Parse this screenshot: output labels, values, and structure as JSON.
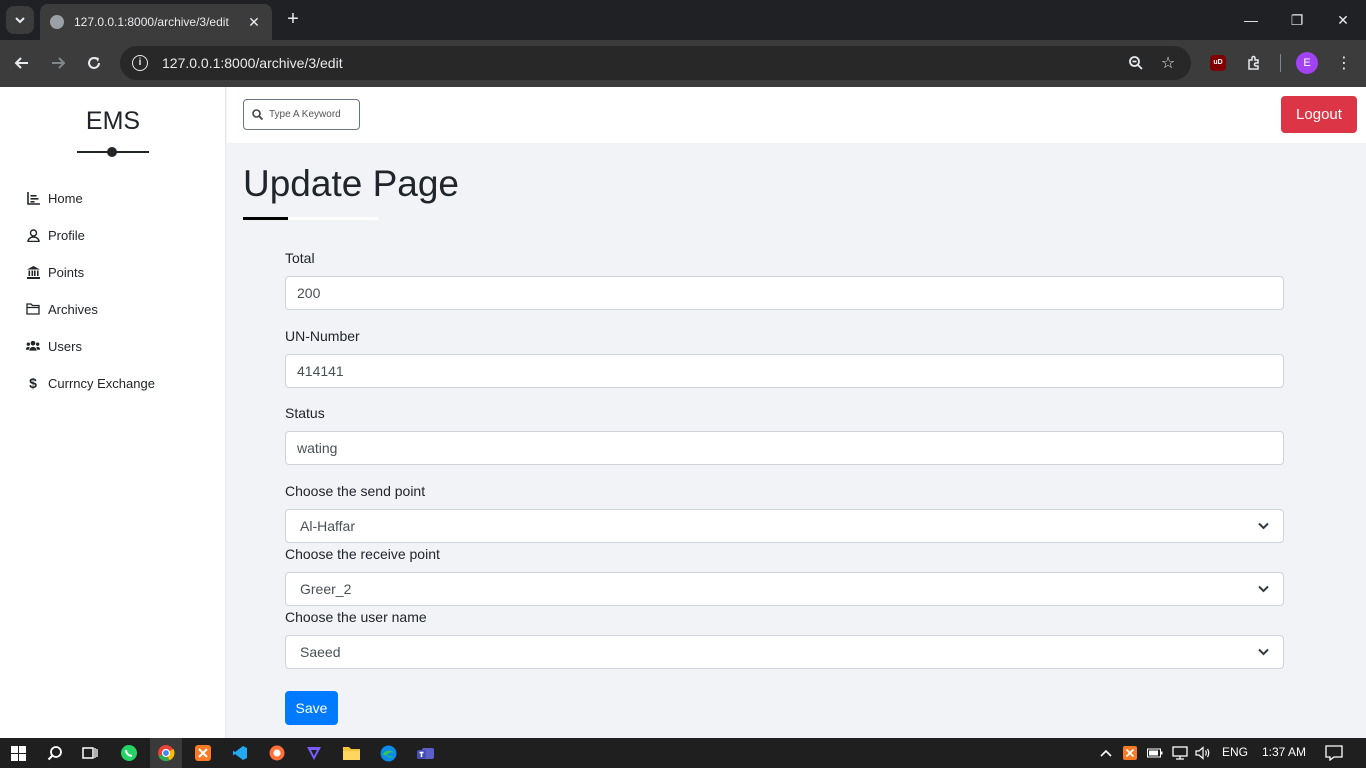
{
  "browser": {
    "tab_title": "127.0.0.1:8000/archive/3/edit",
    "url": "127.0.0.1:8000/archive/3/edit",
    "profile_initial": "E",
    "ublock_label": "uD"
  },
  "sidebar": {
    "brand": "EMS",
    "items": [
      {
        "label": "Home",
        "icon": "chart-icon"
      },
      {
        "label": "Profile",
        "icon": "user-icon"
      },
      {
        "label": "Points",
        "icon": "bank-icon"
      },
      {
        "label": "Archives",
        "icon": "folder-icon"
      },
      {
        "label": "Users",
        "icon": "users-icon"
      },
      {
        "label": "Currncy Exchange",
        "icon": "dollar-icon"
      }
    ]
  },
  "topbar": {
    "search_placeholder": "Type A Keyword",
    "logout_label": "Logout"
  },
  "main": {
    "title": "Update Page",
    "fields": {
      "total_label": "Total",
      "total_value": "200",
      "un_label": "UN-Number",
      "un_value": "414141",
      "status_label": "Status",
      "status_value": "wating",
      "send_label": "Choose the send point",
      "send_value": "Al-Haffar",
      "receive_label": "Choose the receive point",
      "receive_value": "Greer_2",
      "user_label": "Choose the user name",
      "user_value": "Saeed"
    },
    "save_label": "Save"
  },
  "taskbar": {
    "lang": "ENG",
    "time": "1:37 AM"
  },
  "colors": {
    "logout": "#dc3545",
    "save": "#007bff",
    "page_bg": "#f1f3f7"
  }
}
